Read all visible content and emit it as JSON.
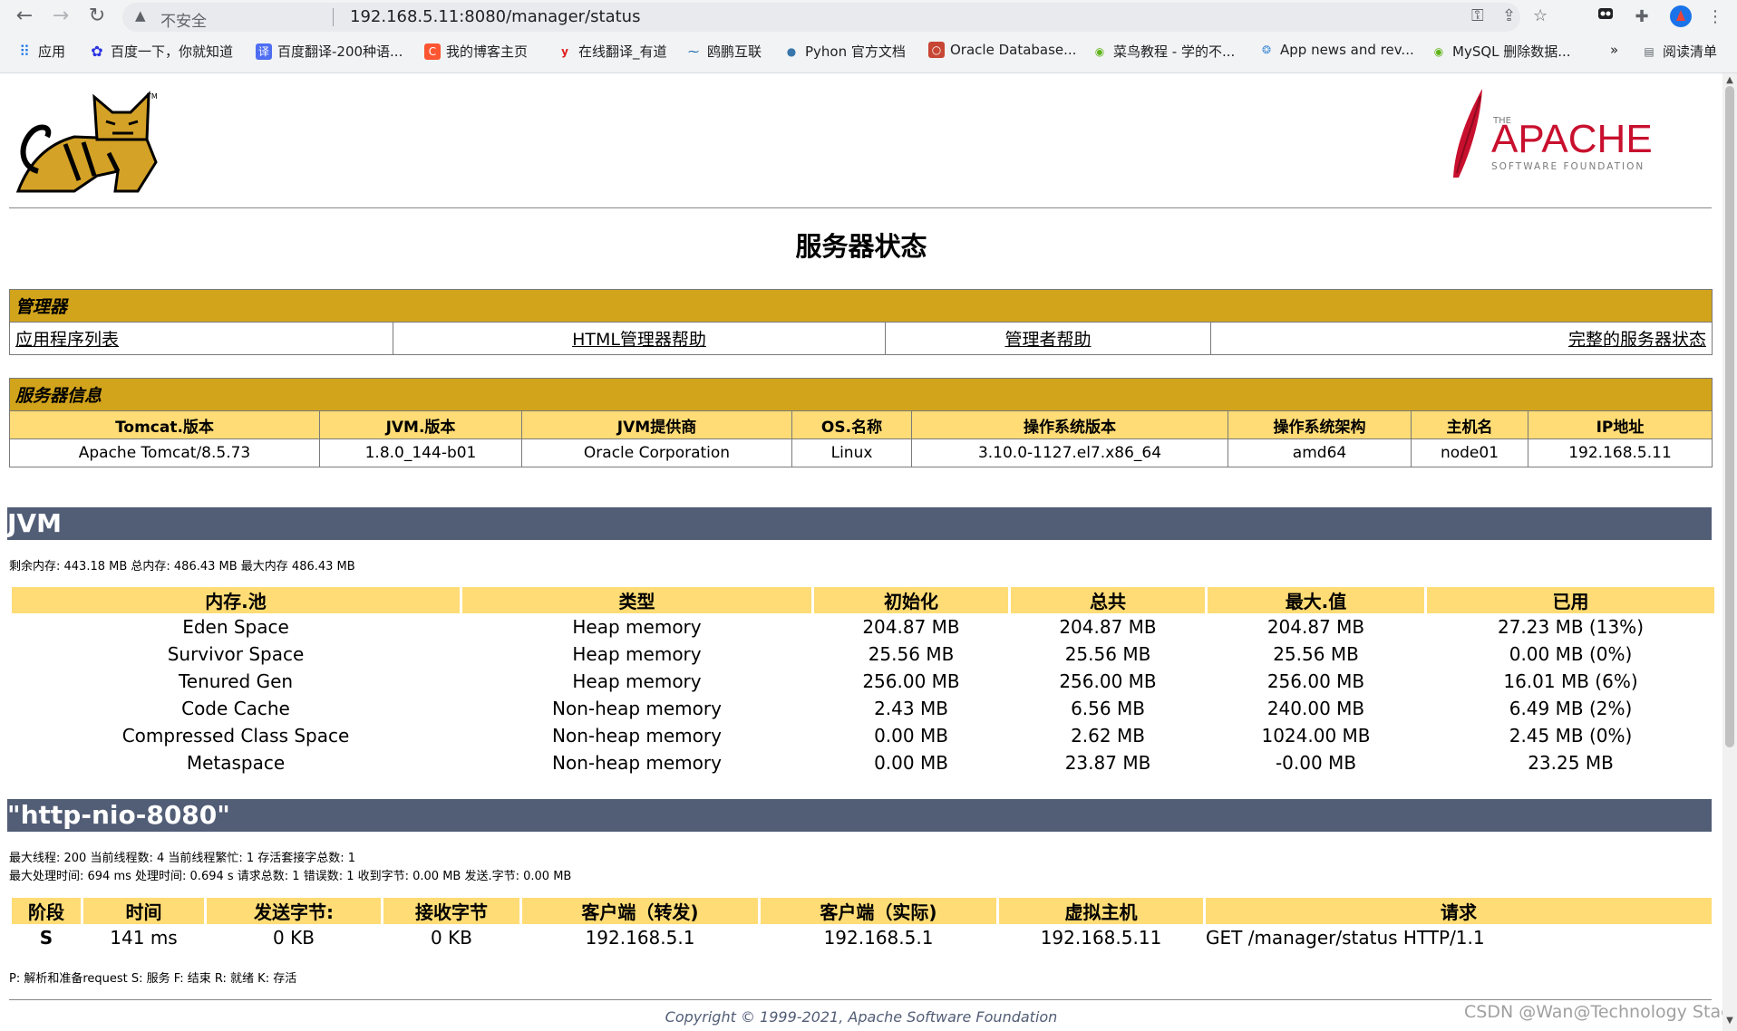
{
  "browser": {
    "security_label": "不安全",
    "url": "192.168.5.11:8080/manager/status",
    "bookmarks": [
      "应用",
      "百度一下，你就知道",
      "百度翻译-200种语...",
      "我的博客主页",
      "在线翻译_有道",
      "鸥鹏互联",
      "Pyhon 官方文档",
      "Oracle Database...",
      "菜鸟教程 - 学的不...",
      "App news and rev...",
      "MySQL 删除数据..."
    ],
    "bookmarks_more": "»",
    "reading_list": "阅读清单"
  },
  "page": {
    "title": "服务器状态",
    "manager": {
      "header": "管理器",
      "links": [
        "应用程序列表",
        "HTML管理器帮助",
        "管理者帮助",
        "完整的服务器状态"
      ]
    },
    "server_info": {
      "header": "服务器信息",
      "columns": [
        "Tomcat.版本",
        "JVM.版本",
        "JVM提供商",
        "OS.名称",
        "操作系统版本",
        "操作系统架构",
        "主机名",
        "IP地址"
      ],
      "values": [
        "Apache Tomcat/8.5.73",
        "1.8.0_144-b01",
        "Oracle Corporation",
        "Linux",
        "3.10.0-1127.el7.x86_64",
        "amd64",
        "node01",
        "192.168.5.11"
      ]
    },
    "jvm": {
      "header": "JVM",
      "summary": "剩余内存:  443.18 MB 总内存:  486.43 MB 最大内存 486.43 MB",
      "columns": [
        "内存.池",
        "类型",
        "初始化",
        "总共",
        "最大.值",
        "已用"
      ],
      "rows": [
        [
          "Eden Space",
          "Heap memory",
          "204.87 MB",
          "204.87 MB",
          "204.87 MB",
          "27.23 MB (13%)"
        ],
        [
          "Survivor Space",
          "Heap memory",
          "25.56 MB",
          "25.56 MB",
          "25.56 MB",
          "0.00 MB (0%)"
        ],
        [
          "Tenured Gen",
          "Heap memory",
          "256.00 MB",
          "256.00 MB",
          "256.00 MB",
          "16.01 MB (6%)"
        ],
        [
          "Code Cache",
          "Non-heap memory",
          "2.43 MB",
          "6.56 MB",
          "240.00 MB",
          "6.49 MB (2%)"
        ],
        [
          "Compressed Class Space",
          "Non-heap memory",
          "0.00 MB",
          "2.62 MB",
          "1024.00 MB",
          "2.45 MB (0%)"
        ],
        [
          "Metaspace",
          "Non-heap memory",
          "0.00 MB",
          "23.87 MB",
          "-0.00 MB",
          "23.25 MB"
        ]
      ]
    },
    "connector": {
      "header": "\"http-nio-8080\"",
      "line1": "最大线程:  200 当前线程数:  4 当前线程繁忙:  1 存活套接字总数:  1",
      "line2": "最大处理时间:  694 ms 处理时间:  0.694 s 请求总数:  1 错误数:  1 收到字节:  0.00 MB 发送.字节: 0.00 MB",
      "columns": [
        "阶段",
        "时间",
        "发送字节:",
        "接收字节",
        "客户端（转发)",
        "客户端（实际)",
        "虚拟主机",
        "请求"
      ],
      "row": [
        "S",
        "141 ms",
        "0 KB",
        "0 KB",
        "192.168.5.1",
        "192.168.5.1",
        "192.168.5.11",
        "GET /manager/status HTTP/1.1"
      ],
      "legend": "P:  解析和准备request S:  服务 F:  结束 R:  就绪 K:  存活"
    },
    "copyright": "Copyright © 1999-2021, Apache Software Foundation",
    "watermark": "CSDN @Wan@Technology Stack"
  },
  "logos": {
    "tomcat_tm": "TM",
    "apache_the": "THE",
    "apache_name": "APACHE",
    "apache_sub": "SOFTWARE FOUNDATION"
  },
  "colors": {
    "section_header": "#d2a41c",
    "table_header": "#ffdc75",
    "band": "#525d76"
  }
}
